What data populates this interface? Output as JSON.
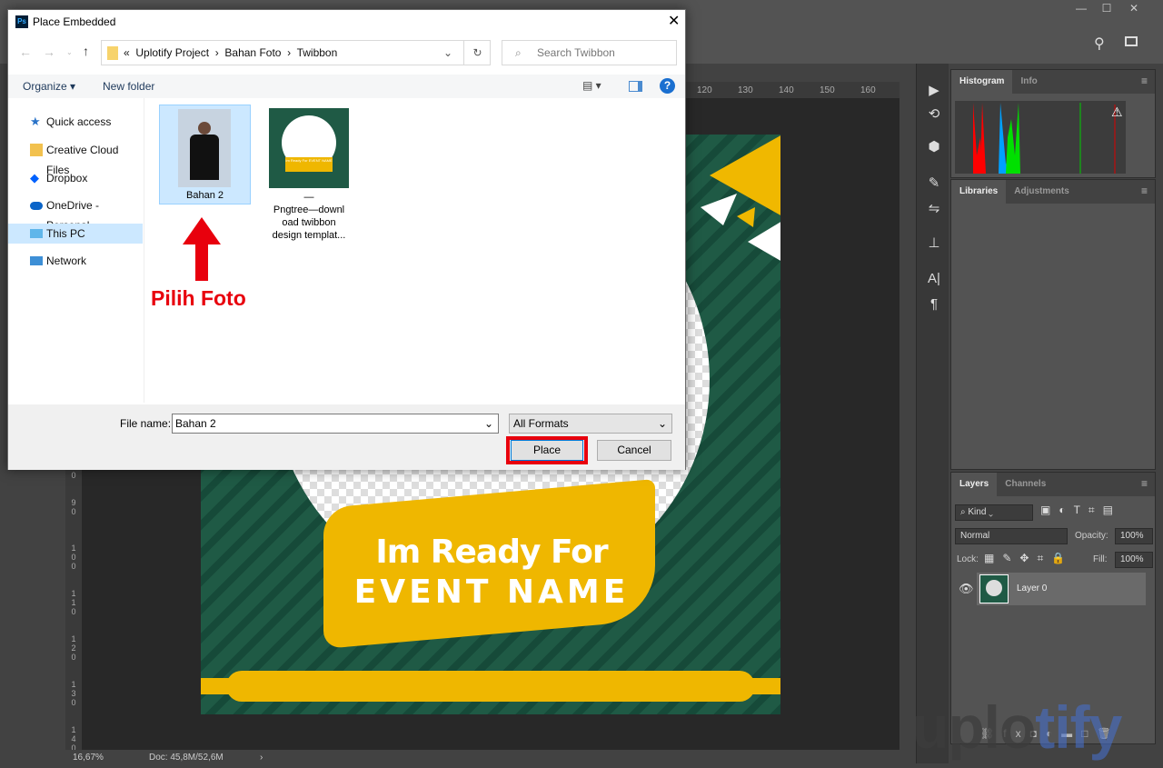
{
  "photoshop": {
    "ruler_top": [
      "120",
      "130",
      "140",
      "150",
      "160"
    ],
    "ruler_left": [
      "0",
      "9",
      "0",
      "1",
      "0",
      "0",
      "1",
      "1",
      "0",
      "1",
      "2",
      "0",
      "1",
      "3",
      "0",
      "1",
      "4",
      "0"
    ],
    "status": {
      "zoom": "16,67%",
      "doc": "Doc: 45,8M/52,6M",
      "arrow": "›"
    },
    "artwork": {
      "line1": "Im Ready For",
      "line2": "EVENT NAME"
    },
    "histogram_panel": {
      "tabs": [
        "Histogram",
        "Info"
      ],
      "warning": "⚠"
    },
    "libraries_panel": {
      "tabs": [
        "Libraries",
        "Adjustments"
      ]
    },
    "layers_panel": {
      "tabs": [
        "Layers",
        "Channels"
      ],
      "filter": "Kind",
      "blend_mode": "Normal",
      "opacity_label": "Opacity:",
      "opacity": "100%",
      "lock_label": "Lock:",
      "fill_label": "Fill:",
      "fill": "100%",
      "layers": [
        {
          "name": "Layer 0",
          "visible": true
        }
      ]
    },
    "watermark": "uplotify"
  },
  "dialog": {
    "title": "Place Embedded",
    "breadcrumb": [
      "«",
      "Uplotify Project",
      "Bahan Foto",
      "Twibbon"
    ],
    "search_placeholder": "Search Twibbon",
    "toolbar": {
      "organize": "Organize ▾",
      "new_folder": "New folder",
      "help": "?"
    },
    "nav": [
      "Quick access",
      "Creative Cloud Files",
      "Dropbox",
      "OneDrive - Personal",
      "This PC",
      "Network"
    ],
    "files": [
      {
        "name": "Bahan 2",
        "selected": true
      },
      {
        "name": "—\nPngtree—downl\noad twibbon\ndesign templat..."
      }
    ],
    "thumbnail_text": "Im Ready For EVENT NAME",
    "annotation": "Pilih Foto",
    "file_name_label": "File name:",
    "file_name_value": "Bahan 2",
    "format": "All Formats",
    "place": "Place",
    "cancel": "Cancel",
    "highlight_color": "#e8000d"
  }
}
